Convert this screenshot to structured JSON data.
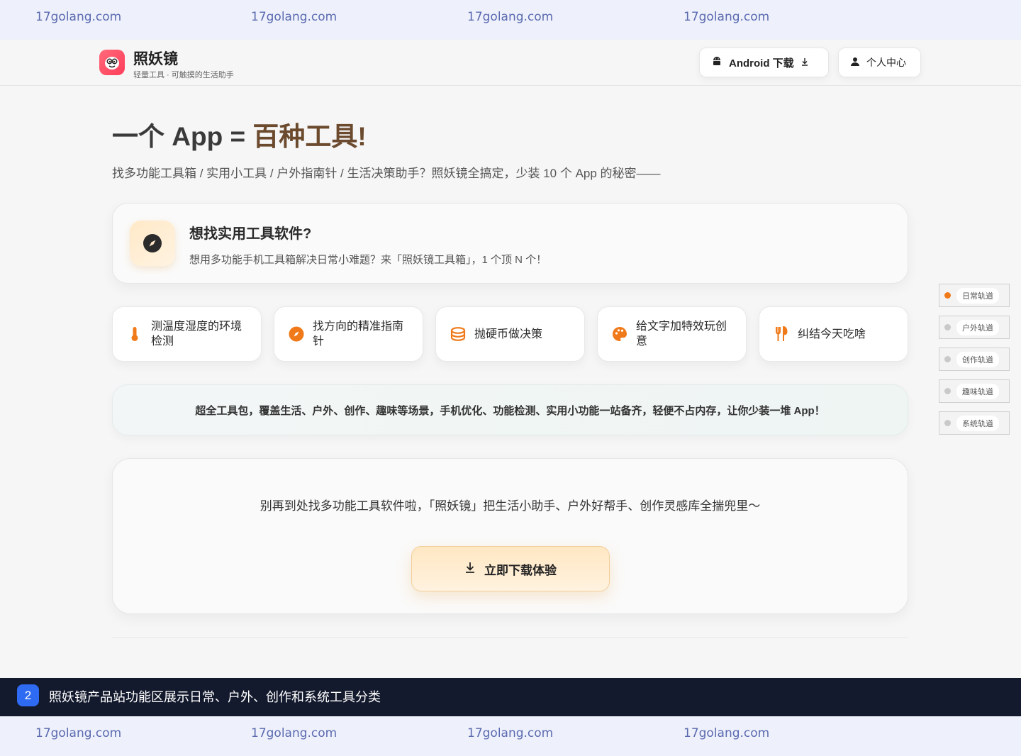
{
  "watermarks": {
    "top": [
      "17golang.com",
      "17golang.com",
      "17golang.com",
      "17golang.com"
    ],
    "bottom": [
      "17golang.com",
      "17golang.com",
      "17golang.com",
      "17golang.com"
    ]
  },
  "header": {
    "brand_name": "照妖镜",
    "tagline": "轻量工具 · 可触摸的生活助手",
    "android_label": "Android 下载",
    "profile_label": "个人中心"
  },
  "hero": {
    "title_prefix": "一个 App = ",
    "title_accent": "百种工具!",
    "subtitle": "找多功能工具箱 / 实用小工具 / 户外指南针 / 生活决策助手？照妖镜全搞定，少装 10 个 App 的秘密——"
  },
  "intro": {
    "title": "想找实用工具软件?",
    "description": "想用多功能手机工具箱解决日常小难题？来「照妖镜工具箱」，1 个顶 N 个！"
  },
  "tiles": [
    {
      "label": "测温度湿度的环境检测",
      "icon": "thermometer-icon"
    },
    {
      "label": "找方向的精准指南针",
      "icon": "compass-icon"
    },
    {
      "label": "抛硬币做决策",
      "icon": "coin-stack-icon"
    },
    {
      "label": "给文字加特效玩创意",
      "icon": "palette-icon"
    },
    {
      "label": "纠结今天吃啥",
      "icon": "fork-knife-icon"
    }
  ],
  "banner": {
    "text": "超全工具包，覆盖生活、户外、创作、趣味等场景，手机优化、功能检测、实用小功能一站备齐，轻便不占内存，让你少装一堆 App！"
  },
  "cta": {
    "text": "别再到处找多功能工具软件啦，「照妖镜」把生活小助手、户外好帮手、创作灵感库全揣兜里～",
    "button_label": "立即下载体验"
  },
  "rail": [
    {
      "label": "日常轨道",
      "active": true
    },
    {
      "label": "户外轨道",
      "active": false
    },
    {
      "label": "创作轨道",
      "active": false
    },
    {
      "label": "趣味轨道",
      "active": false
    },
    {
      "label": "系统轨道",
      "active": false
    }
  ],
  "caption": {
    "number": "2",
    "text": "照妖镜产品站功能区展示日常、户外、创作和系统工具分类"
  },
  "colors": {
    "accent_orange": "#f07a1a",
    "title_brown": "#6b4a2e",
    "caption_bg": "#141a2e",
    "caption_badge": "#2f6bf2"
  }
}
